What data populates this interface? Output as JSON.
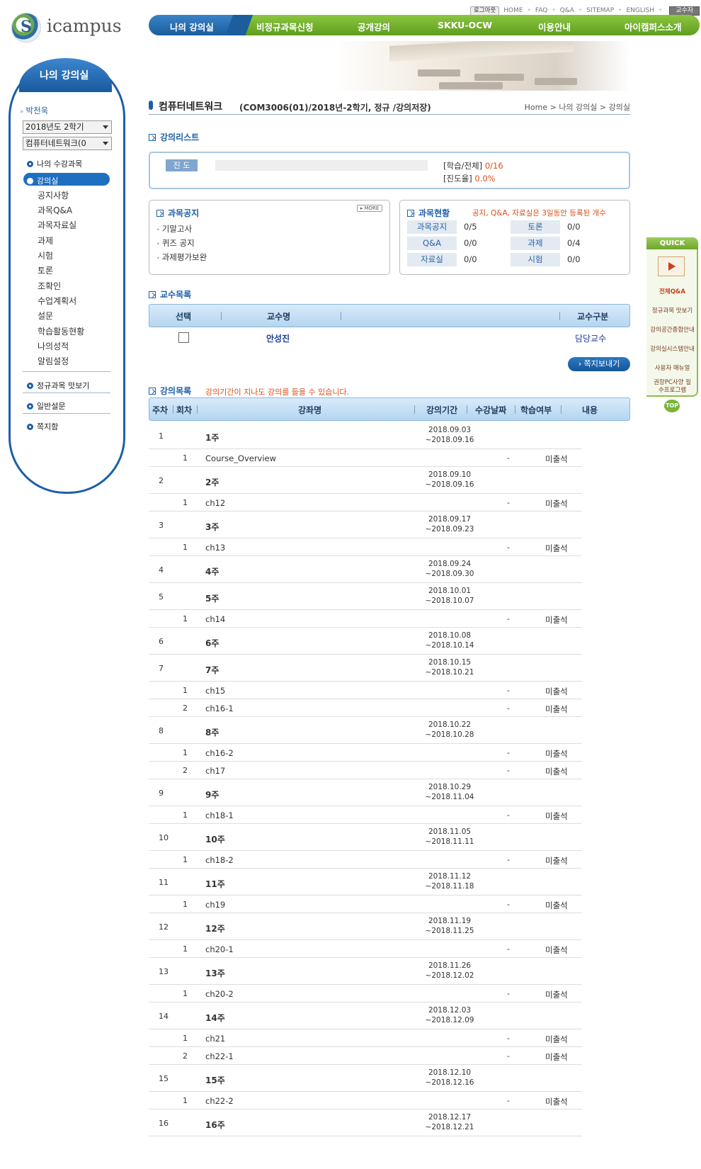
{
  "logo": {
    "text": "icampus"
  },
  "util": {
    "logout": "로그아웃",
    "links": [
      "HOME",
      "FAQ",
      "Q&A",
      "SITEMAP",
      "ENGLISH"
    ],
    "role": "교수자"
  },
  "gnb": [
    "나의 강의실",
    "비정규과목신청",
    "공개강의",
    "SKKU-OCW",
    "이용안내",
    "아이캠퍼스소개"
  ],
  "lnb": {
    "title": "나의 강의실",
    "user": "박천욱",
    "semester": "2018년도 2학기",
    "course": "컴퓨터네트워크(0",
    "my_courses": "나의 수강과목",
    "active": "강의실",
    "subitems": [
      "공지사항",
      "과목Q&A",
      "과목자료실",
      "과제",
      "시험",
      "토론",
      "조확인",
      "수업계획서",
      "설문",
      "학습활동현황",
      "나의성적",
      "알림설정"
    ],
    "extra": [
      "정규과목 맛보기",
      "일반설문",
      "쪽지함"
    ]
  },
  "quick": {
    "title": "QUICK",
    "items": [
      "전체Q&A",
      "정규과목 맛보기",
      "강의공간종합안내",
      "강의실시스템안내",
      "사용자 매뉴얼",
      "권장PC사양 필수프로그램"
    ],
    "top": "TOP"
  },
  "page": {
    "title": "컴퓨터네트워크",
    "subtitle": "(COM3006(01)/2018년-2학기, 정규 /강의저장)",
    "breadcrumb": "Home > 나의 강의실 > 강의실"
  },
  "lecture_list": {
    "title": "강의리스트",
    "progress_label": "진 도",
    "progress_fraction": 0,
    "study_label": "[학습/전체]",
    "study_value": "0/16",
    "rate_label": "[진도율]",
    "rate_value": "0.0%"
  },
  "notice": {
    "title": "과목공지",
    "more": "MORE",
    "items": [
      "기말고사",
      "퀴즈 공지",
      "과제평가보완"
    ]
  },
  "status": {
    "title": "과목현황",
    "note": "공지, Q&A, 자료실은 3일동안 등록된 개수",
    "items": [
      {
        "label": "과목공지",
        "value": "0/5"
      },
      {
        "label": "토론",
        "value": "0/0"
      },
      {
        "label": "Q&A",
        "value": "0/0"
      },
      {
        "label": "과제",
        "value": "0/4"
      },
      {
        "label": "자료실",
        "value": "0/0"
      },
      {
        "label": "시험",
        "value": "0/0"
      }
    ]
  },
  "professors": {
    "title": "교수목록",
    "headers": [
      "선택",
      "교수명",
      "교수구분"
    ],
    "name": "안성진",
    "role": "담당교수",
    "send_button": "쪽지보내기"
  },
  "lectures": {
    "title": "강의목록",
    "note": "강의기간이 지나도 강의를 들을 수 있습니다.",
    "headers": [
      "주차",
      "회차",
      "강좌명",
      "강의기간",
      "수강날짜",
      "학습여부",
      "내용"
    ]
  },
  "rows": [
    {
      "week": "1",
      "name": "1주",
      "period_start": "2018.09.03",
      "period_end": "~2018.09.16"
    },
    {
      "session": "1",
      "name": "Course_Overview",
      "date": "-",
      "status": "미출석"
    },
    {
      "week": "2",
      "name": "2주",
      "period_start": "2018.09.10",
      "period_end": "~2018.09.16"
    },
    {
      "session": "1",
      "name": "ch12",
      "date": "-",
      "status": "미출석"
    },
    {
      "week": "3",
      "name": "3주",
      "period_start": "2018.09.17",
      "period_end": "~2018.09.23"
    },
    {
      "session": "1",
      "name": "ch13",
      "date": "-",
      "status": "미출석"
    },
    {
      "week": "4",
      "name": "4주",
      "period_start": "2018.09.24",
      "period_end": "~2018.09.30"
    },
    {
      "week": "5",
      "name": "5주",
      "period_start": "2018.10.01",
      "period_end": "~2018.10.07"
    },
    {
      "session": "1",
      "name": "ch14",
      "date": "-",
      "status": "미출석"
    },
    {
      "week": "6",
      "name": "6주",
      "period_start": "2018.10.08",
      "period_end": "~2018.10.14"
    },
    {
      "week": "7",
      "name": "7주",
      "period_start": "2018.10.15",
      "period_end": "~2018.10.21"
    },
    {
      "session": "1",
      "name": "ch15",
      "date": "-",
      "status": "미출석"
    },
    {
      "session": "2",
      "name": "ch16-1",
      "date": "-",
      "status": "미출석"
    },
    {
      "week": "8",
      "name": "8주",
      "period_start": "2018.10.22",
      "period_end": "~2018.10.28"
    },
    {
      "session": "1",
      "name": "ch16-2",
      "date": "-",
      "status": "미출석"
    },
    {
      "session": "2",
      "name": "ch17",
      "date": "-",
      "status": "미출석"
    },
    {
      "week": "9",
      "name": "9주",
      "period_start": "2018.10.29",
      "period_end": "~2018.11.04"
    },
    {
      "session": "1",
      "name": "ch18-1",
      "date": "-",
      "status": "미출석"
    },
    {
      "week": "10",
      "name": "10주",
      "period_start": "2018.11.05",
      "period_end": "~2018.11.11"
    },
    {
      "session": "1",
      "name": "ch18-2",
      "date": "-",
      "status": "미출석"
    },
    {
      "week": "11",
      "name": "11주",
      "period_start": "2018.11.12",
      "period_end": "~2018.11.18"
    },
    {
      "session": "1",
      "name": "ch19",
      "date": "-",
      "status": "미출석"
    },
    {
      "week": "12",
      "name": "12주",
      "period_start": "2018.11.19",
      "period_end": "~2018.11.25"
    },
    {
      "session": "1",
      "name": "ch20-1",
      "date": "-",
      "status": "미출석"
    },
    {
      "week": "13",
      "name": "13주",
      "period_start": "2018.11.26",
      "period_end": "~2018.12.02"
    },
    {
      "session": "1",
      "name": "ch20-2",
      "date": "-",
      "status": "미출석"
    },
    {
      "week": "14",
      "name": "14주",
      "period_start": "2018.12.03",
      "period_end": "~2018.12.09"
    },
    {
      "session": "1",
      "name": "ch21",
      "date": "-",
      "status": "미출석"
    },
    {
      "session": "2",
      "name": "ch22-1",
      "date": "-",
      "status": "미출석"
    },
    {
      "week": "15",
      "name": "15주",
      "period_start": "2018.12.10",
      "period_end": "~2018.12.16"
    },
    {
      "session": "1",
      "name": "ch22-2",
      "date": "-",
      "status": "미출석"
    },
    {
      "week": "16",
      "name": "16주",
      "period_start": "2018.12.17",
      "period_end": "~2018.12.21"
    }
  ]
}
